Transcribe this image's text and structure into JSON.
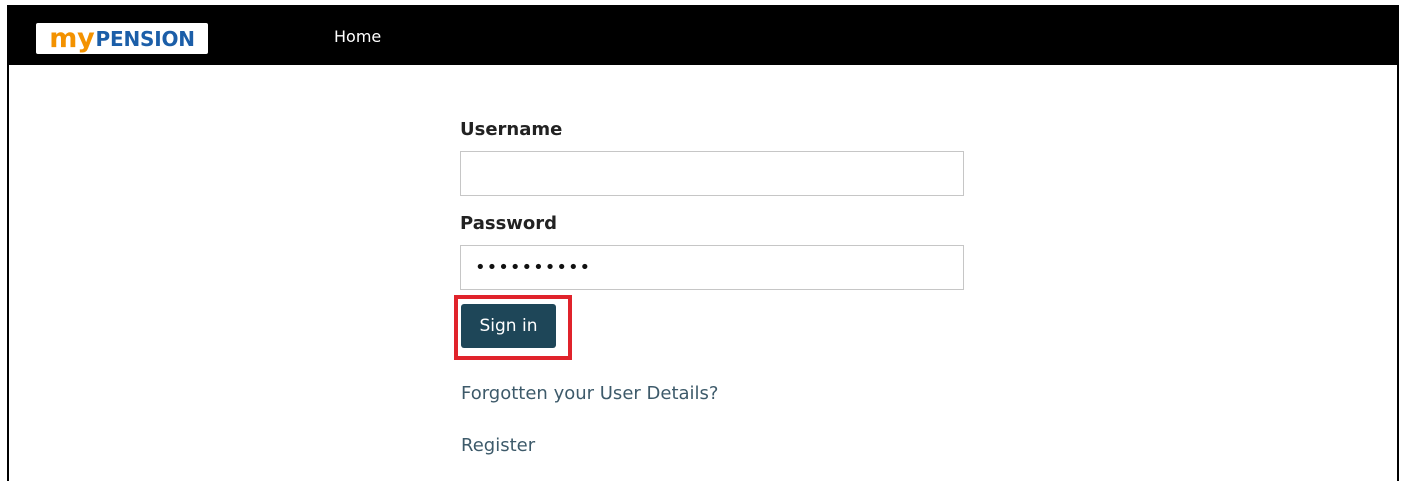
{
  "header": {
    "logo": {
      "my": "my",
      "pension": "PENSION"
    },
    "nav": {
      "home": "Home"
    }
  },
  "login": {
    "username_label": "Username",
    "username_value": "",
    "password_label": "Password",
    "password_value": "••••••••••",
    "signin_label": "Sign in",
    "forgot_link": "Forgotten your User Details?",
    "register_link": "Register"
  },
  "colors": {
    "header_bg": "#000000",
    "logo_orange": "#f39200",
    "logo_blue": "#1b5ea8",
    "button_bg": "#1e4658",
    "highlight": "#e0232b",
    "link": "#3d5a6a"
  }
}
